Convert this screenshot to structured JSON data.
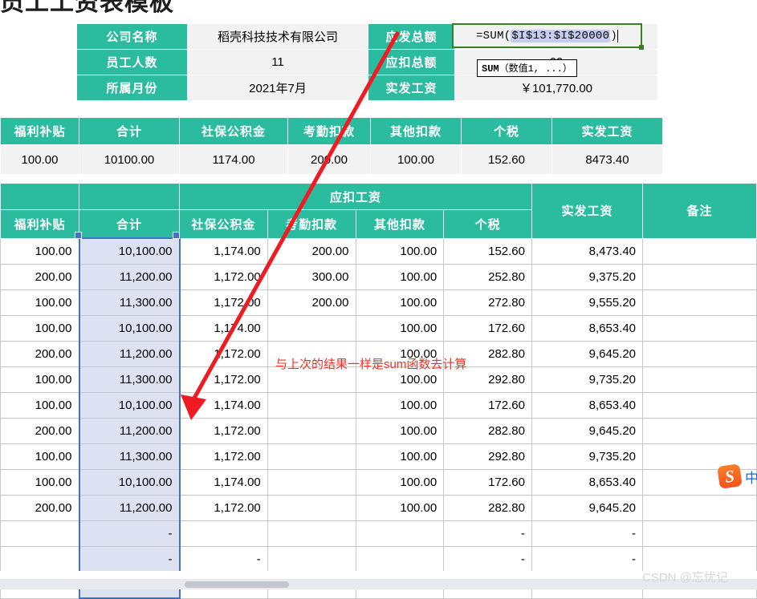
{
  "document": {
    "title_clipped": "员工工资表模板",
    "watermark": "CSDN @忘忧记"
  },
  "info_panel": {
    "rows": [
      {
        "label": "公司名称",
        "value": "稻壳科技技术有限公司",
        "label2": "应发总额",
        "value2": ""
      },
      {
        "label": "员工人数",
        "value": "11",
        "label2": "应扣总额",
        "value2": "00"
      },
      {
        "label": "所属月份",
        "value": "2021年7月",
        "label2": "实发工资",
        "value2": "￥101,770.00"
      }
    ]
  },
  "formula_editor": {
    "prefix": "=SUM(",
    "range": "$I$13:$I$20000",
    "suffix": ")",
    "full_text": "=SUM($I$13:$I$20000)"
  },
  "function_tooltip": {
    "name": "SUM",
    "args": "（数值1, ...）"
  },
  "summary_strip": {
    "headers": [
      "福利补贴",
      "合计",
      "社保公积金",
      "考勤扣款",
      "其他扣款",
      "个税",
      "实发工资"
    ],
    "values": [
      "100.00",
      "10100.00",
      "1174.00",
      "200.00",
      "100.00",
      "152.60",
      "8473.40"
    ]
  },
  "grid": {
    "group_header": "应扣工资",
    "headers": {
      "fuli": "福利补贴",
      "heji": "合计",
      "shebao": "社保公积金",
      "kaoqin": "考勤扣款",
      "qita": "其他扣款",
      "geshui": "个税",
      "shifa": "实发工资",
      "beizhu": "备注"
    },
    "rows": [
      {
        "fuli": "100.00",
        "heji": "10,100.00",
        "shebao": "1,174.00",
        "kaoqin": "200.00",
        "qita": "100.00",
        "geshui": "152.60",
        "shifa": "8,473.40",
        "beizhu": ""
      },
      {
        "fuli": "200.00",
        "heji": "11,200.00",
        "shebao": "1,172.00",
        "kaoqin": "300.00",
        "qita": "100.00",
        "geshui": "252.80",
        "shifa": "9,375.20",
        "beizhu": ""
      },
      {
        "fuli": "100.00",
        "heji": "11,300.00",
        "shebao": "1,172.00",
        "kaoqin": "200.00",
        "qita": "100.00",
        "geshui": "272.80",
        "shifa": "9,555.20",
        "beizhu": ""
      },
      {
        "fuli": "100.00",
        "heji": "10,100.00",
        "shebao": "1,174.00",
        "kaoqin": "",
        "qita": "100.00",
        "geshui": "172.60",
        "shifa": "8,653.40",
        "beizhu": ""
      },
      {
        "fuli": "200.00",
        "heji": "11,200.00",
        "shebao": "1,172.00",
        "kaoqin": "",
        "qita": "100.00",
        "geshui": "282.80",
        "shifa": "9,645.20",
        "beizhu": ""
      },
      {
        "fuli": "100.00",
        "heji": "11,300.00",
        "shebao": "1,172.00",
        "kaoqin": "",
        "qita": "100.00",
        "geshui": "292.80",
        "shifa": "9,735.20",
        "beizhu": ""
      },
      {
        "fuli": "100.00",
        "heji": "10,100.00",
        "shebao": "1,174.00",
        "kaoqin": "",
        "qita": "100.00",
        "geshui": "172.60",
        "shifa": "8,653.40",
        "beizhu": ""
      },
      {
        "fuli": "200.00",
        "heji": "11,200.00",
        "shebao": "1,172.00",
        "kaoqin": "",
        "qita": "100.00",
        "geshui": "282.80",
        "shifa": "9,645.20",
        "beizhu": ""
      },
      {
        "fuli": "100.00",
        "heji": "11,300.00",
        "shebao": "1,172.00",
        "kaoqin": "",
        "qita": "100.00",
        "geshui": "292.80",
        "shifa": "9,735.20",
        "beizhu": ""
      },
      {
        "fuli": "100.00",
        "heji": "10,100.00",
        "shebao": "1,174.00",
        "kaoqin": "",
        "qita": "100.00",
        "geshui": "172.60",
        "shifa": "8,653.40",
        "beizhu": ""
      },
      {
        "fuli": "200.00",
        "heji": "11,200.00",
        "shebao": "1,172.00",
        "kaoqin": "",
        "qita": "100.00",
        "geshui": "282.80",
        "shifa": "9,645.20",
        "beizhu": ""
      },
      {
        "fuli": "",
        "heji": "-",
        "shebao": "",
        "kaoqin": "",
        "qita": "",
        "geshui": "-",
        "shifa": "-",
        "beizhu": ""
      },
      {
        "fuli": "",
        "heji": "-",
        "shebao": "-",
        "kaoqin": "",
        "qita": "",
        "geshui": "-",
        "shifa": "-",
        "beizhu": ""
      },
      {
        "fuli": "",
        "heji": "",
        "shebao": "",
        "kaoqin": "",
        "qita": "",
        "geshui": "",
        "shifa": "",
        "beizhu": ""
      }
    ]
  },
  "annotation": {
    "text": "与上次的结果一样是sum函数去计算",
    "color": "#ff2d20"
  },
  "ime": {
    "logo_letter": "S",
    "mode": "中"
  },
  "colors": {
    "header_teal": "#2bbca0",
    "selection_fill": "#dde2f3",
    "selection_border": "#4372c4",
    "formula_border": "#3a7d27",
    "range_highlight": "#c7cdef"
  }
}
